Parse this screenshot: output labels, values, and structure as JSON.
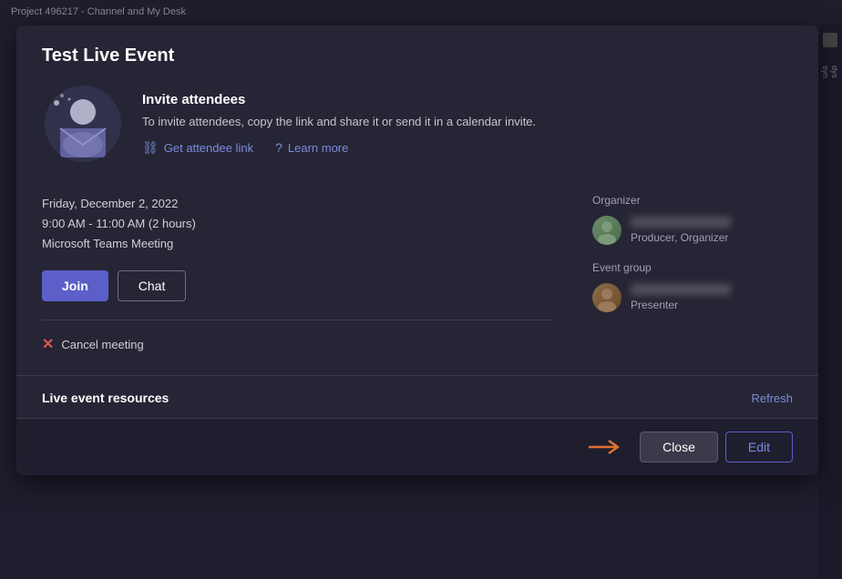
{
  "topbar": {
    "text": "Project 496217 - Channel and My Desk"
  },
  "modal": {
    "title": "Test Live Event",
    "invite": {
      "heading": "Invite attendees",
      "description": "To invite attendees, copy the link and share it or send it in a calendar invite.",
      "get_attendee_link_label": "Get attendee link",
      "learn_more_label": "Learn more"
    },
    "event_details": {
      "date": "Friday, December 2, 2022",
      "time": "9:00 AM - 11:00 AM (2 hours)",
      "platform": "Microsoft Teams Meeting"
    },
    "buttons": {
      "join_label": "Join",
      "chat_label": "Chat"
    },
    "cancel_label": "Cancel meeting",
    "organizer": {
      "section_label": "Organizer",
      "name_placeholder": "[name redacted]",
      "role": "Producer, Organizer"
    },
    "event_group": {
      "section_label": "Event group",
      "name_placeholder": "[name redacted]",
      "role": "Presenter"
    },
    "live_event_resources": {
      "label": "Live event resources",
      "refresh_label": "Refresh"
    },
    "footer": {
      "close_label": "Close",
      "edit_label": "Edit"
    }
  },
  "right_sidebar": {
    "items": [
      "dys",
      "syn"
    ]
  }
}
